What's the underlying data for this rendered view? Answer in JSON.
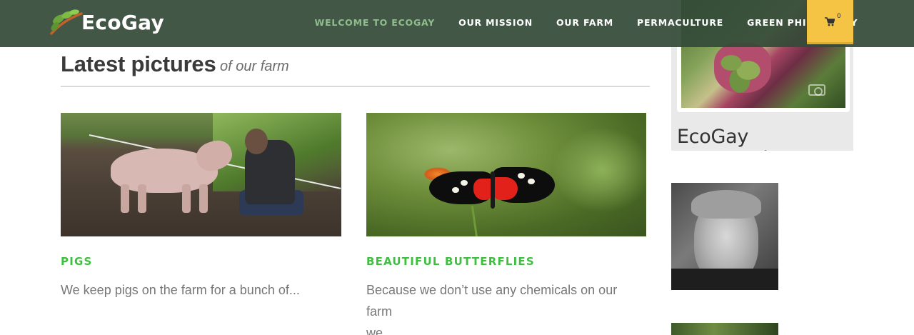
{
  "header": {
    "logo_text": "EcoGay",
    "nav": [
      {
        "label": "WELCOME TO ECOGAY",
        "active": true
      },
      {
        "label": "OUR MISSION",
        "active": false
      },
      {
        "label": "OUR FARM",
        "active": false
      },
      {
        "label": "PERMACULTURE",
        "active": false
      },
      {
        "label": "GREEN PHILOSOPHY",
        "active": false
      }
    ],
    "cart_count": "0",
    "cart_icon": "shopping-cart-icon"
  },
  "section": {
    "title": "Latest pictures",
    "subtitle": "of our farm"
  },
  "cards": [
    {
      "title": "PIGS",
      "excerpt_lines": [
        "We keep pigs on the farm for a bunch of..."
      ],
      "image": "pig-and-man-photo"
    },
    {
      "title": "BEAUTIFUL BUTTERFLIES",
      "excerpt_lines": [
        "Because we don’t use any chemicals on our farm",
        "we..."
      ],
      "image": "butterfly-photo"
    }
  ],
  "sidebar": {
    "community_caption": "EcoGay Community"
  },
  "colors": {
    "header_bg": "#344a38",
    "nav_active": "#8fbf8a",
    "cart_bg": "#f6c444",
    "card_title": "#3fbf3f"
  }
}
